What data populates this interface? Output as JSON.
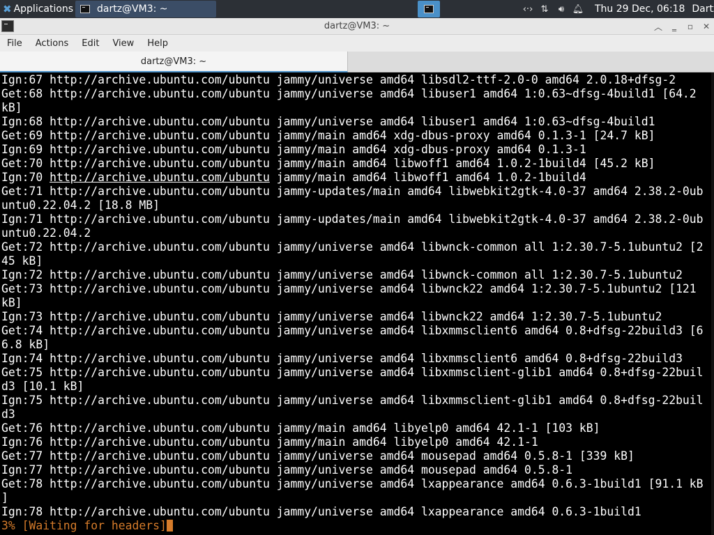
{
  "panel": {
    "apps_label": "Applications",
    "taskbar_title": "dartz@VM3: ~",
    "clock": "Thu 29 Dec, 06:18",
    "user": "Dartz",
    "tray_icons": [
      "code-brackets-icon",
      "network-icon",
      "volume-icon",
      "notification-bell-icon"
    ]
  },
  "window": {
    "title": "dartz@VM3: ~",
    "menu": [
      "File",
      "Actions",
      "Edit",
      "View",
      "Help"
    ],
    "tab_label": "dartz@VM3: ~"
  },
  "terminal": {
    "lines": [
      "Ign:67 http://archive.ubuntu.com/ubuntu jammy/universe amd64 libsdl2-ttf-2.0-0 amd64 2.0.18+dfsg-2",
      "Get:68 http://archive.ubuntu.com/ubuntu jammy/universe amd64 libuser1 amd64 1:0.63~dfsg-4build1 [64.2",
      "kB]",
      "Ign:68 http://archive.ubuntu.com/ubuntu jammy/universe amd64 libuser1 amd64 1:0.63~dfsg-4build1",
      "Get:69 http://archive.ubuntu.com/ubuntu jammy/main amd64 xdg-dbus-proxy amd64 0.1.3-1 [24.7 kB]",
      "Ign:69 http://archive.ubuntu.com/ubuntu jammy/main amd64 xdg-dbus-proxy amd64 0.1.3-1",
      "Get:70 http://archive.ubuntu.com/ubuntu jammy/main amd64 libwoff1 amd64 1.0.2-1build4 [45.2 kB]",
      "Ign:70 http://archive.ubuntu.com/ubuntu jammy/main amd64 libwoff1 amd64 1.0.2-1build4",
      "Get:71 http://archive.ubuntu.com/ubuntu jammy-updates/main amd64 libwebkit2gtk-4.0-37 amd64 2.38.2-0ub",
      "untu0.22.04.2 [18.8 MB]",
      "Ign:71 http://archive.ubuntu.com/ubuntu jammy-updates/main amd64 libwebkit2gtk-4.0-37 amd64 2.38.2-0ub",
      "untu0.22.04.2",
      "Get:72 http://archive.ubuntu.com/ubuntu jammy/universe amd64 libwnck-common all 1:2.30.7-5.1ubuntu2 [2",
      "45 kB]",
      "Ign:72 http://archive.ubuntu.com/ubuntu jammy/universe amd64 libwnck-common all 1:2.30.7-5.1ubuntu2",
      "Get:73 http://archive.ubuntu.com/ubuntu jammy/universe amd64 libwnck22 amd64 1:2.30.7-5.1ubuntu2 [121",
      "kB]",
      "Ign:73 http://archive.ubuntu.com/ubuntu jammy/universe amd64 libwnck22 amd64 1:2.30.7-5.1ubuntu2",
      "Get:74 http://archive.ubuntu.com/ubuntu jammy/universe amd64 libxmmsclient6 amd64 0.8+dfsg-22build3 [6",
      "6.8 kB]",
      "Ign:74 http://archive.ubuntu.com/ubuntu jammy/universe amd64 libxmmsclient6 amd64 0.8+dfsg-22build3",
      "Get:75 http://archive.ubuntu.com/ubuntu jammy/universe amd64 libxmmsclient-glib1 amd64 0.8+dfsg-22buil",
      "d3 [10.1 kB]",
      "Ign:75 http://archive.ubuntu.com/ubuntu jammy/universe amd64 libxmmsclient-glib1 amd64 0.8+dfsg-22buil",
      "d3",
      "Get:76 http://archive.ubuntu.com/ubuntu jammy/main amd64 libyelp0 amd64 42.1-1 [103 kB]",
      "Ign:76 http://archive.ubuntu.com/ubuntu jammy/main amd64 libyelp0 amd64 42.1-1",
      "Get:77 http://archive.ubuntu.com/ubuntu jammy/universe amd64 mousepad amd64 0.5.8-1 [339 kB]",
      "Ign:77 http://archive.ubuntu.com/ubuntu jammy/universe amd64 mousepad amd64 0.5.8-1",
      "Get:78 http://archive.ubuntu.com/ubuntu jammy/universe amd64 lxappearance amd64 0.6.3-1build1 [91.1 kB",
      "]",
      "Ign:78 http://archive.ubuntu.com/ubuntu jammy/universe amd64 lxappearance amd64 0.6.3-1build1"
    ],
    "status_line": "3% [Waiting for headers]",
    "colors": {
      "background": "#000000",
      "text": "#ffffff",
      "status": "#d57b2a"
    }
  }
}
